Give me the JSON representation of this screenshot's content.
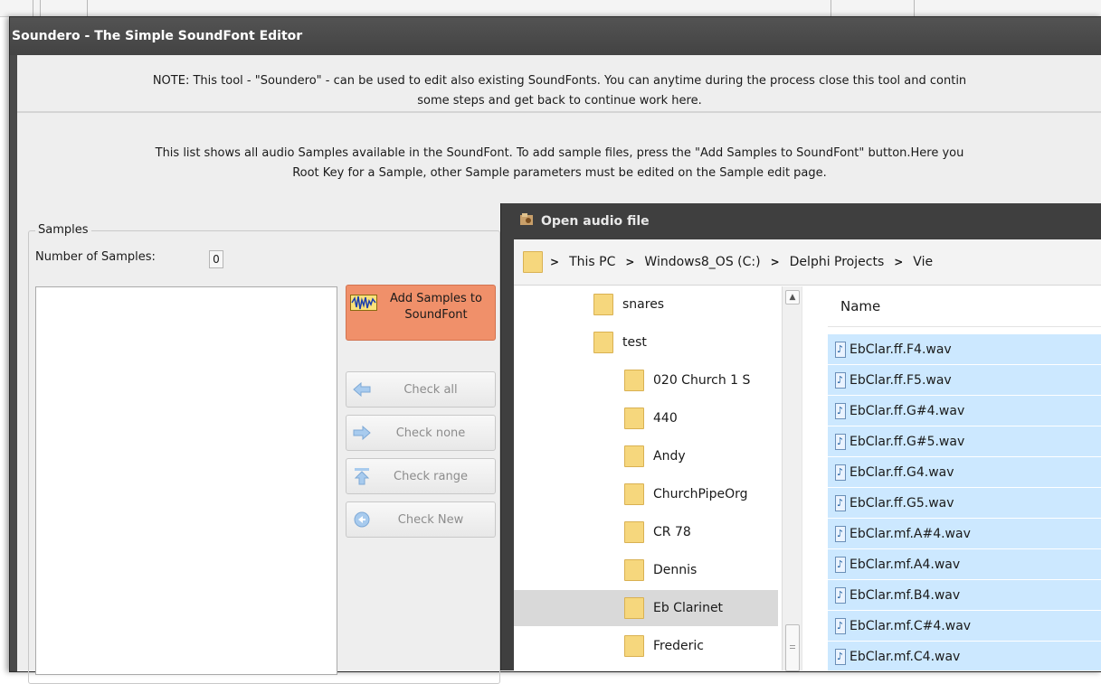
{
  "main_window": {
    "title": "Soundero - The Simple SoundFont Editor",
    "note": "NOTE: This tool - \"Soundero\" - can be used to edit also existing SoundFonts. You can anytime during the process close this tool and contin",
    "note_line2": "some steps and get back to continue work here.",
    "info_line1": "This list shows all audio Samples available in the SoundFont. To add sample files, press the \"Add Samples to SoundFont\" button.Here you",
    "info_line2": "Root Key for a Sample, other Sample parameters must be edited on the Sample edit page.",
    "samples_group": "Samples",
    "num_samples_label": "Number of Samples:",
    "num_samples_value": "0",
    "add_button_line1": "Add Samples to",
    "add_button_line2": "SoundFont",
    "buttons": {
      "check_all": "Check all",
      "check_none": "Check none",
      "check_range": "Check range",
      "check_new": "Check New"
    }
  },
  "dialog": {
    "title": "Open audio file",
    "breadcrumb": [
      "This PC",
      "Windows8_OS (C:)",
      "Delphi Projects",
      "Vie"
    ],
    "tree_items": [
      {
        "label": "snares",
        "indent": 1
      },
      {
        "label": "test",
        "indent": 1
      },
      {
        "label": "020 Church 1 S",
        "indent": 2
      },
      {
        "label": "440",
        "indent": 2
      },
      {
        "label": "Andy",
        "indent": 2
      },
      {
        "label": "ChurchPipeOrg",
        "indent": 2
      },
      {
        "label": "CR 78",
        "indent": 2
      },
      {
        "label": "Dennis",
        "indent": 2
      },
      {
        "label": "Eb Clarinet",
        "indent": 2,
        "selected": true
      },
      {
        "label": "Frederic",
        "indent": 2
      }
    ],
    "column_name": "Name",
    "files": [
      "EbClar.ff.F4.wav",
      "EbClar.ff.F5.wav",
      "EbClar.ff.G#4.wav",
      "EbClar.ff.G#5.wav",
      "EbClar.ff.G4.wav",
      "EbClar.ff.G5.wav",
      "EbClar.mf.A#4.wav",
      "EbClar.mf.A4.wav",
      "EbClar.mf.B4.wav",
      "EbClar.mf.C#4.wav",
      "EbClar.mf.C4.wav"
    ]
  },
  "colors": {
    "add_button": "#f0906a",
    "selection": "#cce8ff",
    "title_bar": "#4a4a4a"
  }
}
